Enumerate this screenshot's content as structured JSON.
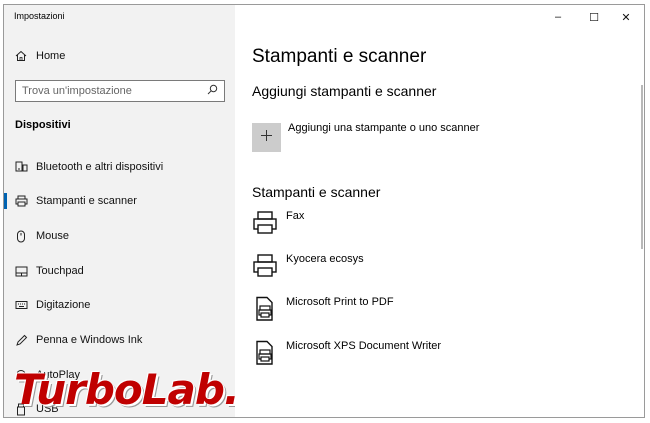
{
  "window": {
    "title": "Impostazioni",
    "minimize_glyph": "–",
    "maximize_glyph": "☐",
    "close_glyph": "✕"
  },
  "sidebar": {
    "home_label": "Home",
    "search_placeholder": "Trova un'impostazione",
    "section_title": "Dispositivi",
    "items": [
      {
        "label": "Bluetooth e altri dispositivi",
        "icon": "bluetooth-device-icon"
      },
      {
        "label": "Stampanti e scanner",
        "icon": "printer-icon",
        "active": true
      },
      {
        "label": "Mouse",
        "icon": "mouse-icon"
      },
      {
        "label": "Touchpad",
        "icon": "touchpad-icon"
      },
      {
        "label": "Digitazione",
        "icon": "keyboard-icon"
      },
      {
        "label": "Penna e Windows Ink",
        "icon": "pen-icon"
      },
      {
        "label": "AutoPlay",
        "icon": "autoplay-icon"
      },
      {
        "label": "USB",
        "icon": "usb-icon"
      }
    ]
  },
  "main": {
    "page_title": "Stampanti e scanner",
    "add_section_title": "Aggiungi stampanti e scanner",
    "add_label": "Aggiungi una stampante o uno scanner",
    "list_section_title": "Stampanti e scanner",
    "printers": [
      {
        "name": "Fax",
        "icon": "printer-icon"
      },
      {
        "name": "Kyocera ecosys",
        "icon": "printer-icon"
      },
      {
        "name": "Microsoft Print to PDF",
        "icon": "document-printer-icon"
      },
      {
        "name": "Microsoft XPS Document Writer",
        "icon": "document-printer-icon"
      }
    ]
  },
  "watermark": "TurboLab.it",
  "colors": {
    "accent": "#0063b1",
    "sidebar_bg": "#f2f2f2",
    "add_button_bg": "#cccccc",
    "watermark": "#c00000"
  }
}
